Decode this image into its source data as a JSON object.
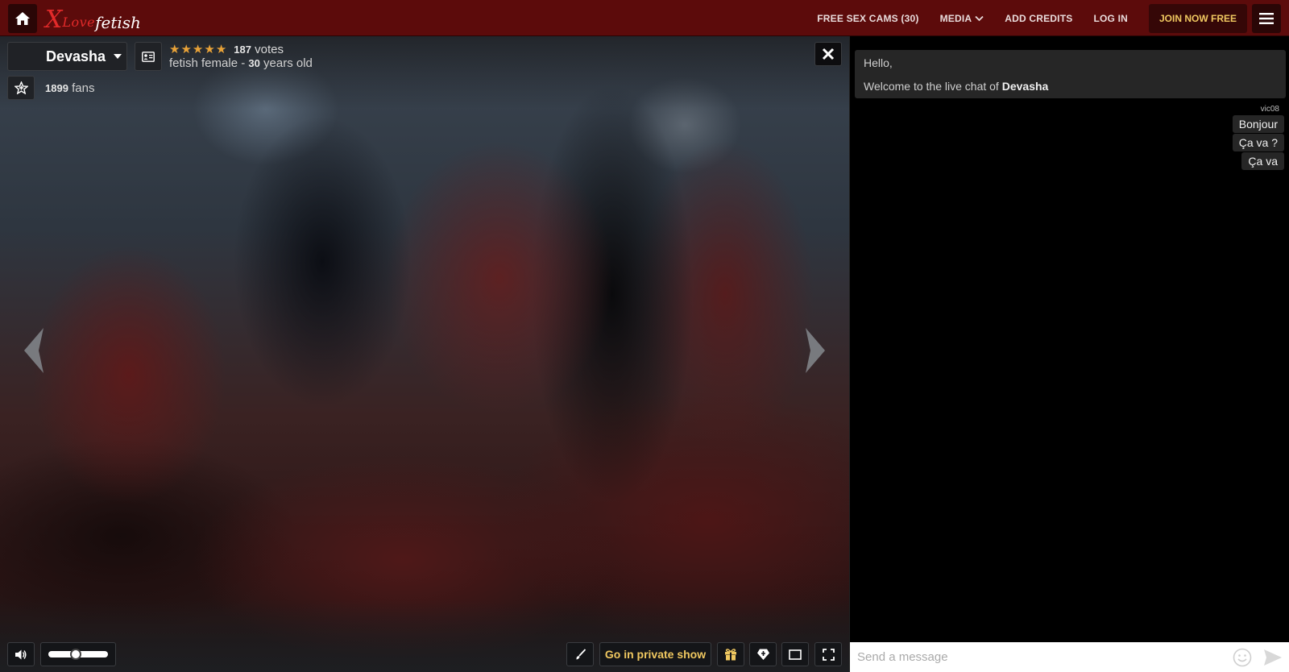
{
  "topbar": {
    "logo": {
      "x": "X",
      "love": "Love",
      "fetish": "fetish"
    },
    "nav": {
      "free_cams": "FREE SEX CAMS (30)",
      "media": "MEDIA",
      "add_credits": "ADD CREDITS",
      "log_in": "LOG IN",
      "join": "JOIN NOW FREE"
    }
  },
  "model": {
    "name": "Devasha",
    "votes_count": "187",
    "votes_label": "votes",
    "category": "fetish female",
    "age": "30",
    "age_label": "years old",
    "fans_count": "1899",
    "fans_label": "fans",
    "rating": 5
  },
  "player": {
    "private_show_label": "Go in private show",
    "volume": 0.45
  },
  "chat": {
    "welcome_line1": "Hello,",
    "welcome_line2": "Welcome to the live chat of",
    "welcome_name": "Devasha",
    "messages_user": "vic08",
    "messages": [
      "Bonjour",
      "Ça va ?",
      "Ça va"
    ],
    "placeholder": "Send a message"
  },
  "colors": {
    "topbar_bg": "#5c0b0b",
    "accent_gold": "#f0c860",
    "star": "#e8a238",
    "logo_red": "#e22a2a"
  },
  "icons": [
    "home-icon",
    "menu-icon",
    "chevron-down-icon",
    "profile-card-icon",
    "star-icon",
    "favorite-star-icon",
    "close-icon",
    "arrow-left-icon",
    "arrow-right-icon",
    "speaker-icon",
    "brush-icon",
    "gift-icon",
    "tip-icon",
    "theater-mode-icon",
    "fullscreen-icon",
    "emoji-icon",
    "send-icon"
  ]
}
